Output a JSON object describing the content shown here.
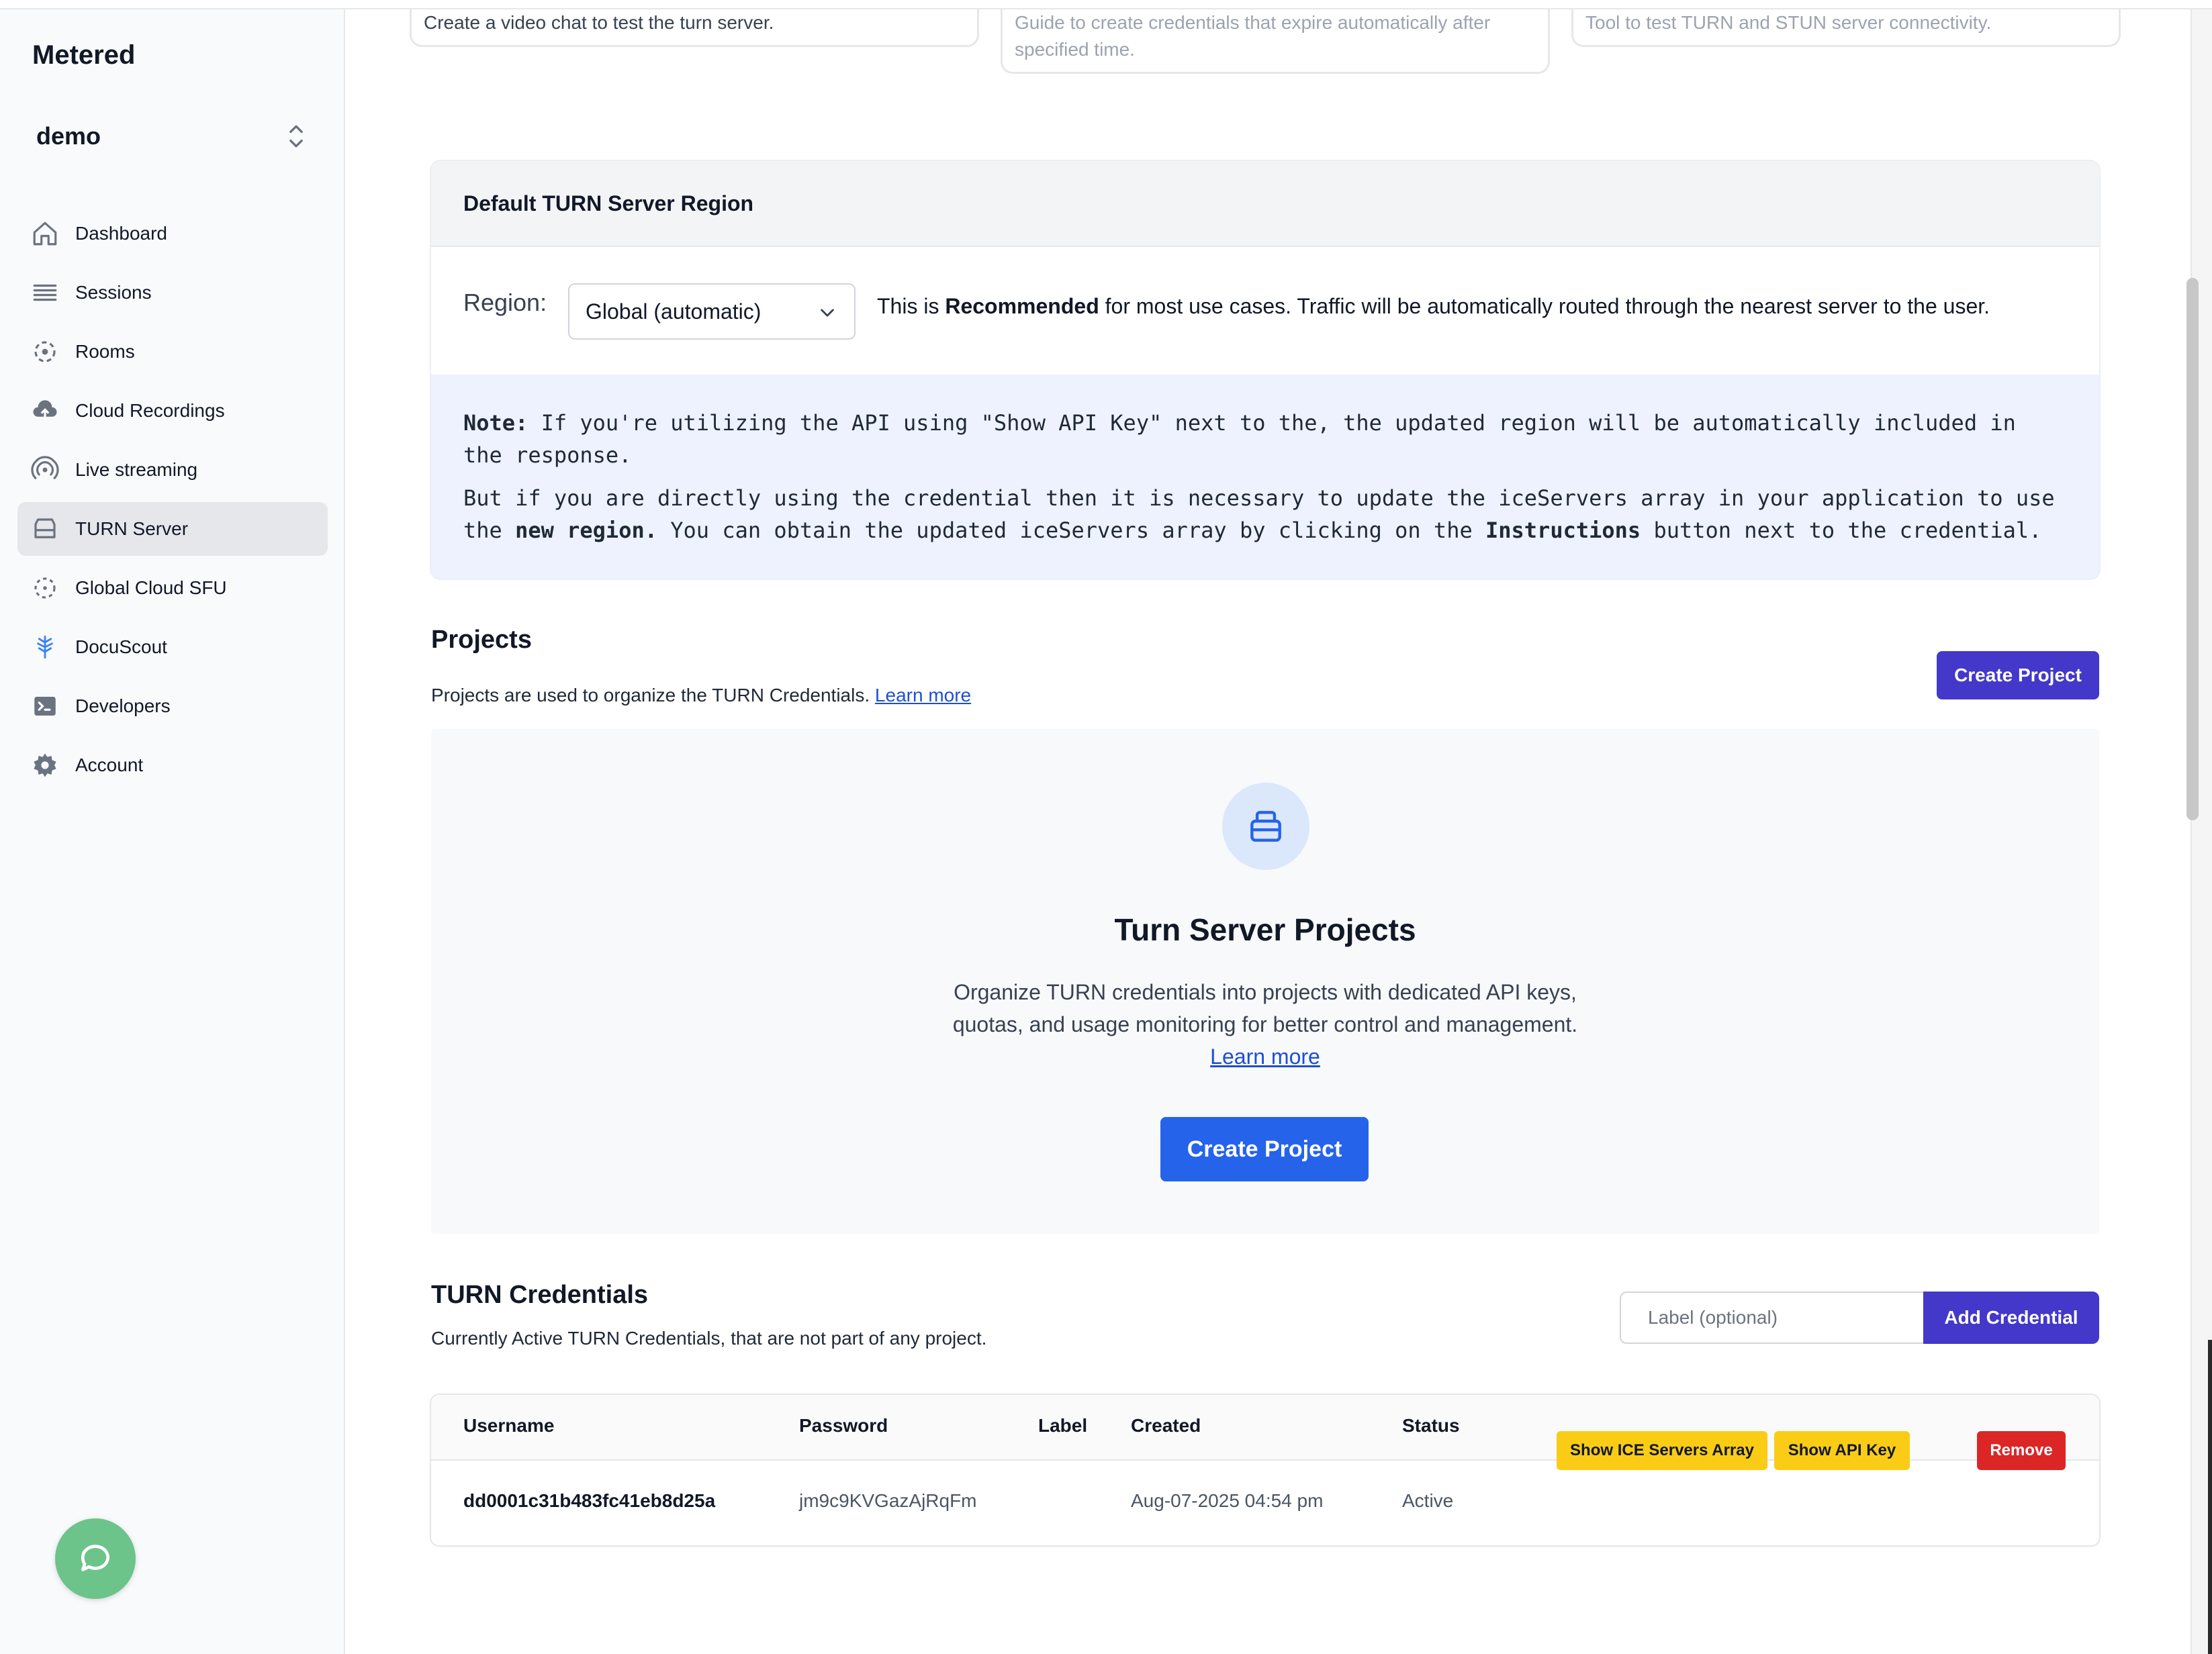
{
  "sidebar": {
    "logo": "Metered",
    "team": "demo",
    "items": [
      {
        "label": "Dashboard",
        "icon": "home-icon",
        "active": false
      },
      {
        "label": "Sessions",
        "icon": "list-icon",
        "active": false
      },
      {
        "label": "Rooms",
        "icon": "rooms-icon",
        "active": false
      },
      {
        "label": "Cloud Recordings",
        "icon": "cloud-upload-icon",
        "active": false
      },
      {
        "label": "Live streaming",
        "icon": "broadcast-icon",
        "active": false
      },
      {
        "label": "TURN Server",
        "icon": "server-icon",
        "active": true
      },
      {
        "label": "Global Cloud SFU",
        "icon": "sfu-icon",
        "active": false
      },
      {
        "label": "DocuScout",
        "icon": "docuscout-icon",
        "active": false
      },
      {
        "label": "Developers",
        "icon": "terminal-icon",
        "active": false
      },
      {
        "label": "Account",
        "icon": "gear-icon",
        "active": false
      }
    ]
  },
  "top_cards": [
    {
      "text": "Create a video chat to test the turn server."
    },
    {
      "text_line1": "Guide to create credentials that expire automatically after",
      "text_line2": "specified time."
    },
    {
      "text": "Tool to test TURN and STUN server connectivity."
    }
  ],
  "region": {
    "heading": "Default TURN Server Region",
    "label": "Region:",
    "selected": "Global (automatic)",
    "desc_prefix": "This is ",
    "desc_bold": "Recommended",
    "desc_suffix": " for most use cases. Traffic will be automatically routed through the nearest server to the user.",
    "note_label": "Note:",
    "note_line1": " If you're utilizing the API using \"Show API Key\" next to the, the updated region will be automatically included in the response.",
    "note2_prefix": "But if you are directly using the credential then it is necessary to update the iceServers array in your application to use the ",
    "note2_bold1": "new region.",
    "note2_mid": " You can obtain the updated iceServers array by clicking on the ",
    "note2_bold2": "Instructions",
    "note2_suffix": " button next to the credential."
  },
  "projects": {
    "title": "Projects",
    "subtitle": "Projects are used to organize the TURN Credentials.",
    "learn_more": "Learn more",
    "create_button": "Create Project",
    "empty_title": "Turn Server Projects",
    "empty_text": "Organize TURN credentials into projects with dedicated API keys, quotas, and usage monitoring for better control and management.",
    "empty_learn_more": "Learn more",
    "empty_create_button": "Create Project"
  },
  "credentials": {
    "title": "TURN Credentials",
    "subtitle": "Currently Active TURN Credentials, that are not part of any project.",
    "label_placeholder": "Label (optional)",
    "add_button": "Add Credential",
    "columns": [
      "Username",
      "Password",
      "Label",
      "Created",
      "Status"
    ],
    "rows": [
      {
        "username": "dd0001c31b483fc41eb8d25a",
        "password": "jm9c9KVGazAjRqFm",
        "label": "",
        "created": "Aug-07-2025 04:54 pm",
        "status": "Active",
        "ice_button": "Show ICE Servers Array",
        "api_button": "Show API Key",
        "remove_button": "Remove"
      }
    ]
  },
  "colors": {
    "accent_indigo": "#4338ca",
    "primary_blue": "#2563eb",
    "warning_yellow": "#facc15",
    "danger_red": "#dc2626",
    "chat_green": "#6cc48b"
  }
}
